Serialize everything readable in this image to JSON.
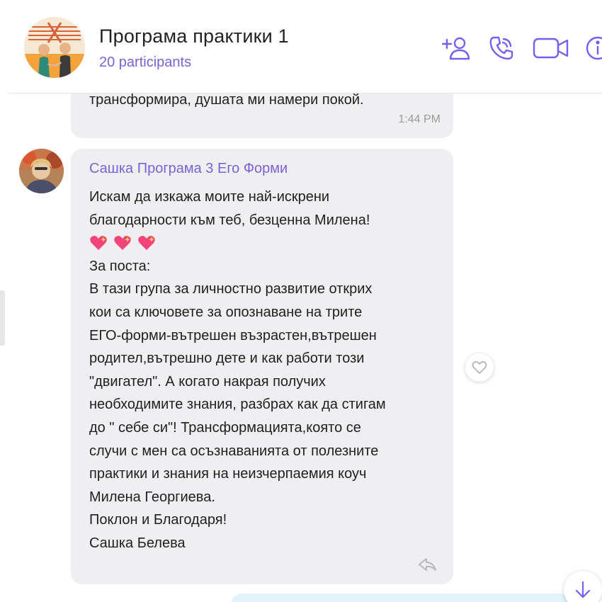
{
  "header": {
    "title": "Програма практики 1",
    "participants": "20 participants",
    "icons": [
      "add-participant-icon",
      "voice-call-icon",
      "video-call-icon",
      "info-icon"
    ]
  },
  "previous_message": {
    "text": "трансформира, душата ми намери покой.",
    "time": "1:44 PM"
  },
  "message": {
    "sender": "Сашка Програма 3 Его Форми",
    "lines": [
      "Искам да изкажа моите най-искрени",
      "благодарности към теб, безценна Милена!",
      "За поста:",
      "В тази група за личностно развитие открих",
      "кои са ключовете за опознаване на трите",
      "ЕГО-форми-вътрешен възрастен,вътрешен",
      "родител,вътрешно дете и как работи този",
      "\"двигател\". А когато накрая получих",
      "необходимите знания, разбрах как да стигам",
      "до \" себе си\"! Трансформацията,която се",
      "случи с мен са осъзнаванията от полезните",
      "практики и знания на неизчерпаемия коуч",
      "Милена Георгиева.",
      "Поклон и Благодаря!",
      "Сашка Белева"
    ],
    "emoji": [
      "sparkling-heart",
      "sparkling-heart",
      "sparkling-heart"
    ]
  },
  "colors": {
    "accent": "#7360f2",
    "sender_name": "#7b62d6",
    "bubble": "#efeff1",
    "outgoing_bubble": "#e3f1fb"
  }
}
